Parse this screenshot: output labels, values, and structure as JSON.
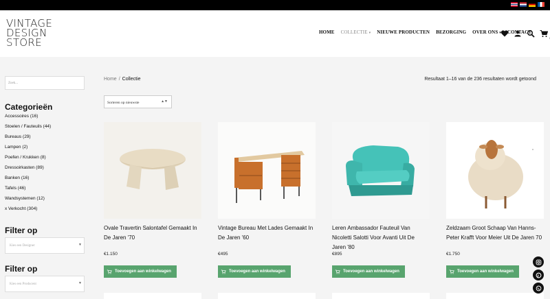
{
  "languages": [
    {
      "code": "en",
      "icon": "flag-uk-icon"
    },
    {
      "code": "nl",
      "icon": "flag-nl-icon"
    },
    {
      "code": "de",
      "icon": "flag-de-icon"
    },
    {
      "code": "fr",
      "icon": "flag-fr-icon"
    }
  ],
  "logo": {
    "line1": "VINTAGE",
    "line2": "DESIGN",
    "line3": "STORE"
  },
  "nav": {
    "home": "HOME",
    "collectie": "COLLECTIE",
    "nieuwe": "NIEUWE PRODUCTEN",
    "bezorging": "BEZORGING",
    "over_ons": "OVER ONS",
    "contact": "CONTACT",
    "cart_count": "0"
  },
  "sidebar": {
    "search_placeholder": "Zoek...",
    "categories_title": "Categorieën",
    "categories": [
      {
        "name": "Accessoires",
        "count": "(16)"
      },
      {
        "name": "Stoelen / Fauteuils",
        "count": "(44)"
      },
      {
        "name": "Bureaus",
        "count": "(29)"
      },
      {
        "name": "Lampen",
        "count": "(2)"
      },
      {
        "name": "Poefen / Krukken",
        "count": "(8)"
      },
      {
        "name": "Dressoirkasten",
        "count": "(89)"
      },
      {
        "name": "Banken",
        "count": "(16)"
      },
      {
        "name": "Tafels",
        "count": "(46)"
      },
      {
        "name": "Wandsystemen",
        "count": "(12)"
      },
      {
        "name": "x Verkocht",
        "count": "(304)"
      }
    ],
    "filter1_title": "Filter op",
    "filter1_placeholder": "Kies een Designer",
    "filter2_title": "Filter op",
    "filter2_placeholder": "Kies een Producent"
  },
  "breadcrumb": {
    "home": "Home",
    "sep": "/",
    "current": "Collectie"
  },
  "results_text": "Resultaat 1–16 van de 236 resultaten wordt getoond",
  "sort_label": "Sorteren op nieuwste",
  "products": [
    {
      "name": "Ovale Travertin Salontafel Gemaakt In De Jaren '70",
      "price": "€1.150",
      "button": "Toevoegen aan winkelwagen"
    },
    {
      "name": "Vintage Bureau Met Lades Gemaakt In De Jaren '60",
      "price": "€495",
      "button": "Toevoegen aan winkelwagen"
    },
    {
      "name": "Leren Ambassador Fauteuil Van Nicoletti Salotti Voor Avanti Uit De Jaren '80",
      "price": "€895",
      "button": "Toevoegen aan winkelwagen"
    },
    {
      "name": "Zeldzaam Groot Schaap Van Hanns-Peter Krafft Voor Meier Uit De Jaren 70",
      "price": "€1.750",
      "button": "Toevoegen aan winkelwagen"
    }
  ],
  "colors": {
    "button": "#58a46e",
    "topbar": "#000000",
    "background": "#f4f4f4"
  }
}
